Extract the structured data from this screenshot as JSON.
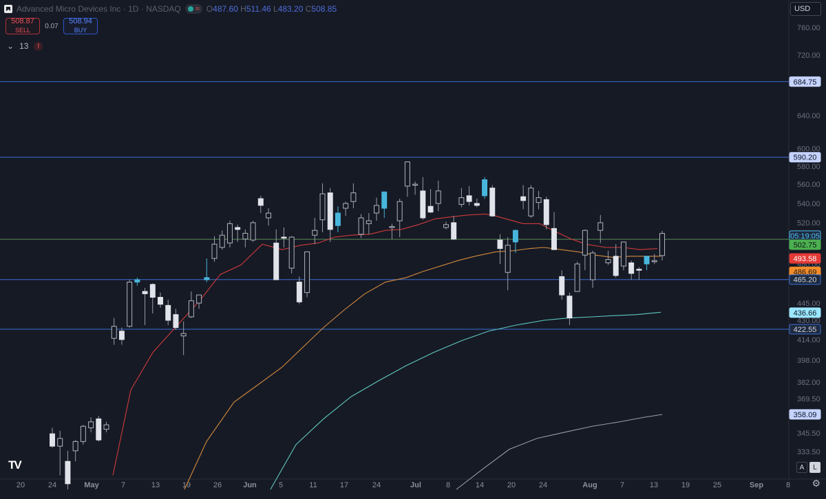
{
  "header": {
    "title": "Advanced Micro Devices Inc · 1D · NASDAQ",
    "open_label": "O",
    "open": "487.60",
    "high_label": "H",
    "high": "511.46",
    "low_label": "L",
    "low": "483.20",
    "close_label": "C",
    "close": "508.85",
    "wave_glyph": "≈"
  },
  "trade": {
    "sell_price": "508.87",
    "sell_label": "SELL",
    "spread": "0.07",
    "buy_price": "508.94",
    "buy_label": "BUY"
  },
  "indicators": {
    "toggle_glyph": "⌄",
    "count": "13",
    "warning_glyph": "!"
  },
  "currency": "USD",
  "controls": {
    "logo_text": "TV",
    "auto_label": "A",
    "log_label": "L",
    "settings_glyph": "⚙"
  },
  "colors": {
    "bg": "#161a25",
    "up_body": "#161a25",
    "up_border": "#b2b5be",
    "down_body": "#e1e3ea",
    "highlight": "#48b6dc",
    "wick": "#9a9da8",
    "hline": "#3a6fd1",
    "green_line": "#5b8e5b",
    "ma_red": "#d13b3b",
    "ma_orange": "#d58a3c",
    "ma_teal": "#5fc9c0",
    "ma_gray": "#9a9da8"
  },
  "chart_data": {
    "type": "candlestick",
    "symbol": "Advanced Micro Devices Inc",
    "interval": "1D",
    "exchange": "NASDAQ",
    "ylim": [
      320,
      780
    ],
    "y_ticks": [
      "760.00",
      "720.00",
      "640.00",
      "600.00",
      "580.00",
      "560.00",
      "540.00",
      "520.00",
      "500.00",
      "480.00",
      "445.00",
      "430.00",
      "414.00",
      "398.00",
      "382.00",
      "369.50",
      "357.50",
      "345.50",
      "333.50"
    ],
    "x_ticks": [
      "20",
      "24",
      "May",
      "7",
      "13",
      "19",
      "26",
      "Jun",
      "5",
      "11",
      "17",
      "24",
      "Jul",
      "8",
      "14",
      "20",
      "24",
      "Aug",
      "7",
      "13",
      "19",
      "25",
      "Sep",
      "8"
    ],
    "horizontal_levels": [
      {
        "value": 684.75,
        "label": "684.75",
        "color": "#3a6fd1"
      },
      {
        "value": 590.2,
        "label": "590.20",
        "color": "#3a6fd1"
      },
      {
        "value": 465.2,
        "label": "465.20",
        "color": "#3a6fd1"
      },
      {
        "value": 422.55,
        "label": "422.55",
        "color": "#3a6fd1"
      },
      {
        "value": 502.75,
        "label": "502.75",
        "color": "#5b8e5b"
      }
    ],
    "price_labels": [
      {
        "text": "05:19:05",
        "value": 506.5,
        "bg": "#1e2a3f",
        "fg": "#4fc3f7",
        "border": "#4fc3f7"
      },
      {
        "text": "502.75",
        "value": 497.5,
        "bg": "#4caf50",
        "fg": "#0b1410"
      },
      {
        "text": "493.58",
        "value": 485,
        "bg": "#e53935",
        "fg": "#ffffff"
      },
      {
        "text": "486.69",
        "value": 472.5,
        "bg": "#f28c28",
        "fg": "#1a1a1a"
      },
      {
        "text": "465.20",
        "value": 465.2,
        "bg": "#1e2a3f",
        "fg": "#d1d4dc",
        "border": "#3a6fd1"
      },
      {
        "text": "436.66",
        "value": 436.66,
        "bg": "#9be7ff",
        "fg": "#0b1c26"
      },
      {
        "text": "422.55",
        "value": 422.55,
        "bg": "#1e2a3f",
        "fg": "#d1d4dc",
        "border": "#3a6fd1"
      },
      {
        "text": "358.09",
        "value": 358.09,
        "bg": "#c5d3ff",
        "fg": "#0b1426"
      },
      {
        "text": "684.75",
        "value": 684.75,
        "bg": "#c5d3ff",
        "fg": "#0b1426"
      },
      {
        "text": "590.20",
        "value": 590.2,
        "bg": "#c5d3ff",
        "fg": "#0b1426"
      }
    ],
    "candles": [
      {
        "o": 345,
        "h": 349,
        "l": 336,
        "c": 337
      },
      {
        "o": 337,
        "h": 347,
        "l": 325,
        "c": 342
      },
      {
        "o": 330,
        "h": 334,
        "l": 318,
        "c": 322
      },
      {
        "o": 334,
        "h": 341,
        "l": 330,
        "c": 340
      },
      {
        "o": 340,
        "h": 351,
        "l": 338,
        "c": 350
      },
      {
        "o": 349,
        "h": 356,
        "l": 346,
        "c": 353
      },
      {
        "o": 355,
        "h": 357,
        "l": 340,
        "c": 341
      },
      {
        "o": 348,
        "h": 353,
        "l": 346,
        "c": 351
      },
      {
        "o": 415,
        "h": 432,
        "l": 410,
        "c": 425
      },
      {
        "o": 421,
        "h": 424,
        "l": 410,
        "c": 414
      },
      {
        "o": 425,
        "h": 465,
        "l": 424,
        "c": 463
      },
      {
        "o": 463,
        "h": 467,
        "l": 460,
        "c": 465,
        "hl": true
      },
      {
        "o": 455,
        "h": 458,
        "l": 426,
        "c": 453
      },
      {
        "o": 461,
        "h": 462,
        "l": 436,
        "c": 450
      },
      {
        "o": 450,
        "h": 454,
        "l": 441,
        "c": 444
      },
      {
        "o": 443,
        "h": 448,
        "l": 426,
        "c": 430
      },
      {
        "o": 435,
        "h": 440,
        "l": 422,
        "c": 424
      },
      {
        "o": 417,
        "h": 429,
        "l": 402,
        "c": 419
      },
      {
        "o": 433,
        "h": 455,
        "l": 432,
        "c": 447
      },
      {
        "o": 445,
        "h": 452,
        "l": 440,
        "c": 452
      },
      {
        "o": 465,
        "h": 485,
        "l": 463,
        "c": 467,
        "hl": true
      },
      {
        "o": 485,
        "h": 506,
        "l": 482,
        "c": 498
      },
      {
        "o": 495,
        "h": 512,
        "l": 493,
        "c": 507
      },
      {
        "o": 499,
        "h": 522,
        "l": 495,
        "c": 519
      },
      {
        "o": 515,
        "h": 518,
        "l": 500,
        "c": 513
      },
      {
        "o": 503,
        "h": 513,
        "l": 495,
        "c": 509
      },
      {
        "o": 502,
        "h": 522,
        "l": 500,
        "c": 520
      },
      {
        "o": 545,
        "h": 548,
        "l": 530,
        "c": 538
      },
      {
        "o": 525,
        "h": 535,
        "l": 517,
        "c": 530
      },
      {
        "o": 499,
        "h": 513,
        "l": 478,
        "c": 465
      },
      {
        "o": 505,
        "h": 515,
        "l": 495,
        "c": 504
      },
      {
        "o": 476,
        "h": 506,
        "l": 471,
        "c": 505
      },
      {
        "o": 463,
        "h": 468,
        "l": 444,
        "c": 446
      },
      {
        "o": 454,
        "h": 484,
        "l": 450,
        "c": 491
      },
      {
        "o": 507,
        "h": 525,
        "l": 498,
        "c": 512
      },
      {
        "o": 523,
        "h": 561,
        "l": 510,
        "c": 550
      },
      {
        "o": 551,
        "h": 556,
        "l": 500,
        "c": 513
      },
      {
        "o": 517,
        "h": 537,
        "l": 510,
        "c": 530,
        "hl": true
      },
      {
        "o": 535,
        "h": 542,
        "l": 527,
        "c": 540
      },
      {
        "o": 542,
        "h": 561,
        "l": 535,
        "c": 551
      },
      {
        "o": 508,
        "h": 529,
        "l": 504,
        "c": 525
      },
      {
        "o": 519,
        "h": 530,
        "l": 508,
        "c": 522
      },
      {
        "o": 530,
        "h": 546,
        "l": 522,
        "c": 538
      },
      {
        "o": 535,
        "h": 545,
        "l": 525,
        "c": 552,
        "hl": true
      },
      {
        "o": 515,
        "h": 519,
        "l": 503,
        "c": 516
      },
      {
        "o": 522,
        "h": 545,
        "l": 505,
        "c": 542
      },
      {
        "o": 558,
        "h": 583,
        "l": 547,
        "c": 585
      },
      {
        "o": 559,
        "h": 563,
        "l": 549,
        "c": 560
      },
      {
        "o": 553,
        "h": 568,
        "l": 523,
        "c": 525
      },
      {
        "o": 537,
        "h": 555,
        "l": 530,
        "c": 531
      },
      {
        "o": 540,
        "h": 564,
        "l": 532,
        "c": 553
      },
      {
        "o": 515,
        "h": 521,
        "l": 513,
        "c": 518
      },
      {
        "o": 520,
        "h": 527,
        "l": 502,
        "c": 503
      },
      {
        "o": 539,
        "h": 556,
        "l": 536,
        "c": 546
      },
      {
        "o": 548,
        "h": 558,
        "l": 538,
        "c": 542
      },
      {
        "o": 540,
        "h": 545,
        "l": 536,
        "c": 538
      },
      {
        "o": 548,
        "h": 568,
        "l": 545,
        "c": 565,
        "hl": true
      },
      {
        "o": 556,
        "h": 559,
        "l": 526,
        "c": 527
      },
      {
        "o": 502,
        "h": 508,
        "l": 480,
        "c": 494
      },
      {
        "o": 472,
        "h": 505,
        "l": 456,
        "c": 497
      },
      {
        "o": 500,
        "h": 513,
        "l": 490,
        "c": 512,
        "hl": true
      },
      {
        "o": 547,
        "h": 559,
        "l": 534,
        "c": 543
      },
      {
        "o": 527,
        "h": 559,
        "l": 525,
        "c": 556
      },
      {
        "o": 541,
        "h": 553,
        "l": 534,
        "c": 546
      },
      {
        "o": 544,
        "h": 547,
        "l": 513,
        "c": 518
      },
      {
        "o": 514,
        "h": 531,
        "l": 493,
        "c": 493
      },
      {
        "o": 468,
        "h": 474,
        "l": 448,
        "c": 452
      },
      {
        "o": 451,
        "h": 454,
        "l": 426,
        "c": 432
      },
      {
        "o": 455,
        "h": 482,
        "l": 455,
        "c": 480
      },
      {
        "o": 488,
        "h": 513,
        "l": 474,
        "c": 512
      },
      {
        "o": 465,
        "h": 492,
        "l": 458,
        "c": 490
      },
      {
        "o": 512,
        "h": 528,
        "l": 499,
        "c": 520
      },
      {
        "o": 481,
        "h": 492,
        "l": 479,
        "c": 484
      },
      {
        "o": 487,
        "h": 498,
        "l": 467,
        "c": 469
      },
      {
        "o": 478,
        "h": 500,
        "l": 474,
        "c": 500
      },
      {
        "o": 481,
        "h": 483,
        "l": 465,
        "c": 471
      },
      {
        "o": 475,
        "h": 477,
        "l": 465,
        "c": 474
      },
      {
        "o": 480,
        "h": 484,
        "l": 474,
        "c": 487,
        "hl": true
      },
      {
        "o": 482,
        "h": 489,
        "l": 480,
        "c": 483
      },
      {
        "o": 487.6,
        "h": 511.46,
        "l": 483.2,
        "c": 508.85
      }
    ],
    "ma_series": [
      {
        "color": "#d13b3b",
        "values": [
          [
            164,
            325
          ],
          [
            190,
            376
          ],
          [
            222,
            404
          ],
          [
            261,
            428
          ],
          [
            290,
            447
          ],
          [
            320,
            470
          ],
          [
            350,
            479
          ],
          [
            381,
            498
          ],
          [
            410,
            493
          ],
          [
            437,
            497
          ],
          [
            462,
            499
          ],
          [
            486,
            505
          ],
          [
            510,
            507
          ],
          [
            537,
            508
          ],
          [
            560,
            512
          ],
          [
            583,
            513
          ],
          [
            608,
            518
          ],
          [
            632,
            524
          ],
          [
            655,
            526
          ],
          [
            680,
            528
          ],
          [
            705,
            529
          ],
          [
            720,
            527
          ],
          [
            740,
            523
          ],
          [
            760,
            519
          ],
          [
            784,
            519
          ],
          [
            806,
            511
          ],
          [
            830,
            503
          ],
          [
            851,
            498
          ],
          [
            880,
            495
          ],
          [
            905,
            495
          ],
          [
            930,
            493
          ],
          [
            955,
            494
          ]
        ]
      },
      {
        "color": "#d58a3c",
        "values": [
          [
            268,
            320
          ],
          [
            300,
            340
          ],
          [
            340,
            367
          ],
          [
            380,
            382
          ],
          [
            410,
            393
          ],
          [
            440,
            408
          ],
          [
            470,
            424
          ],
          [
            500,
            439
          ],
          [
            530,
            453
          ],
          [
            560,
            463
          ],
          [
            590,
            467
          ],
          [
            615,
            473
          ],
          [
            640,
            478
          ],
          [
            665,
            483
          ],
          [
            690,
            487
          ],
          [
            720,
            491
          ],
          [
            745,
            492
          ],
          [
            770,
            494
          ],
          [
            790,
            495
          ],
          [
            815,
            493
          ],
          [
            840,
            491
          ],
          [
            865,
            488
          ],
          [
            890,
            486
          ],
          [
            915,
            487
          ],
          [
            940,
            487
          ],
          [
            960,
            487
          ]
        ]
      },
      {
        "color": "#5fc9c0",
        "values": [
          [
            393,
            320
          ],
          [
            430,
            338
          ],
          [
            470,
            355
          ],
          [
            510,
            371
          ],
          [
            550,
            383
          ],
          [
            590,
            394
          ],
          [
            630,
            404
          ],
          [
            670,
            413
          ],
          [
            710,
            421
          ],
          [
            750,
            426
          ],
          [
            790,
            430
          ],
          [
            825,
            432
          ],
          [
            860,
            433
          ],
          [
            890,
            434
          ],
          [
            925,
            435
          ],
          [
            960,
            437
          ]
        ]
      },
      {
        "color": "#9a9da8",
        "values": [
          [
            663,
            320
          ],
          [
            700,
            327
          ],
          [
            740,
            335
          ],
          [
            780,
            342
          ],
          [
            820,
            346
          ],
          [
            860,
            350
          ],
          [
            900,
            353
          ],
          [
            935,
            356
          ],
          [
            962,
            358
          ]
        ]
      }
    ]
  }
}
